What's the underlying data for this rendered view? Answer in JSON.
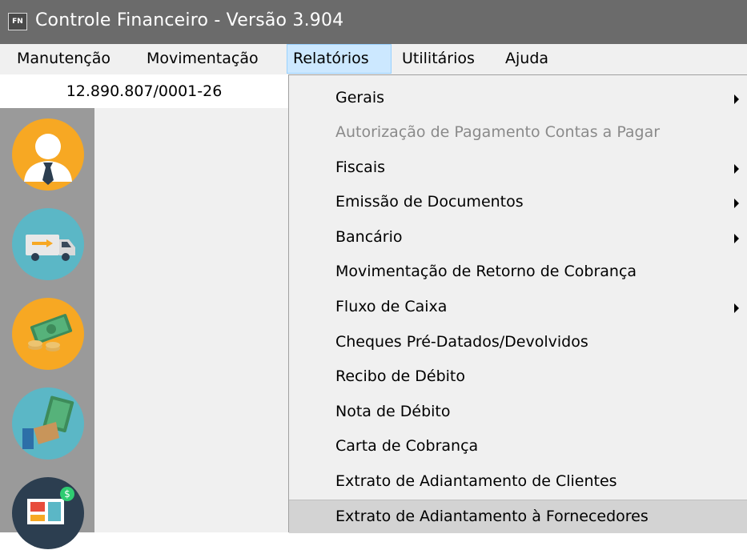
{
  "window": {
    "title": "Controle Financeiro - Versão 3.904",
    "icon_text": "FN"
  },
  "menubar": {
    "items": [
      {
        "label": "Manutenção"
      },
      {
        "label": "Movimentação"
      },
      {
        "label": "Relatórios"
      },
      {
        "label": "Utilitários"
      },
      {
        "label": "Ajuda"
      }
    ]
  },
  "company": {
    "cnpj": "12.890.807/0001-26"
  },
  "sidebar": {
    "icons": [
      "user-icon",
      "delivery-truck-icon",
      "money-icon",
      "payment-hand-icon",
      "laptop-finance-icon"
    ]
  },
  "dropdown": {
    "items": [
      {
        "label": "Gerais",
        "submenu": true,
        "disabled": false
      },
      {
        "label": "Autorização de Pagamento Contas a Pagar",
        "submenu": false,
        "disabled": true
      },
      {
        "label": "Fiscais",
        "submenu": true,
        "disabled": false
      },
      {
        "label": "Emissão de Documentos",
        "submenu": true,
        "disabled": false
      },
      {
        "label": "Bancário",
        "submenu": true,
        "disabled": false
      },
      {
        "label": "Movimentação de Retorno de Cobrança",
        "submenu": false,
        "disabled": false
      },
      {
        "label": "Fluxo de Caixa",
        "submenu": true,
        "disabled": false
      },
      {
        "label": "Cheques Pré-Datados/Devolvidos",
        "submenu": false,
        "disabled": false
      },
      {
        "label": "Recibo de Débito",
        "submenu": false,
        "disabled": false
      },
      {
        "label": "Nota de Débito",
        "submenu": false,
        "disabled": false
      },
      {
        "label": "Carta de Cobrança",
        "submenu": false,
        "disabled": false
      },
      {
        "label": "Extrato de Adiantamento de Clientes",
        "submenu": false,
        "disabled": false
      },
      {
        "label": "Extrato de Adiantamento à Fornecedores",
        "submenu": false,
        "disabled": false,
        "highlighted": true
      }
    ]
  },
  "colors": {
    "titlebar": "#6b6b6b",
    "menu_active": "#cce8ff",
    "sidebar_strip": "#9a9a9a",
    "icon_orange": "#f7a823",
    "icon_teal": "#5bb7c6",
    "icon_dark": "#2c3e50"
  }
}
